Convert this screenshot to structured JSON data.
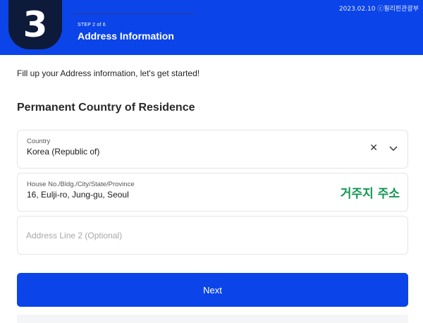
{
  "header": {
    "step_number": "3",
    "step_counter": "STEP 2 of 6",
    "title": "Address Information",
    "watermark": "2023.02.10 ⓒ필리핀관광부"
  },
  "intro": "Fill up your Address information, let's get started!",
  "section_title": "Permanent Country of Residence",
  "country_field": {
    "label": "Country",
    "value": "Korea (Republic of)",
    "clear_icon": "close-icon",
    "dropdown_icon": "chevron-down-icon"
  },
  "address_field": {
    "label": "House No./Bldg./City/State/Province",
    "value": "16, Eulji-ro, Jung-gu, Seoul",
    "annotation": "거주지 주소"
  },
  "address2_field": {
    "placeholder": "Address Line 2 (Optional)",
    "value": ""
  },
  "next_button": {
    "label": "Next"
  },
  "colors": {
    "primary": "#0b44e8",
    "badge": "#0d1a3a",
    "annotation": "#119650"
  }
}
